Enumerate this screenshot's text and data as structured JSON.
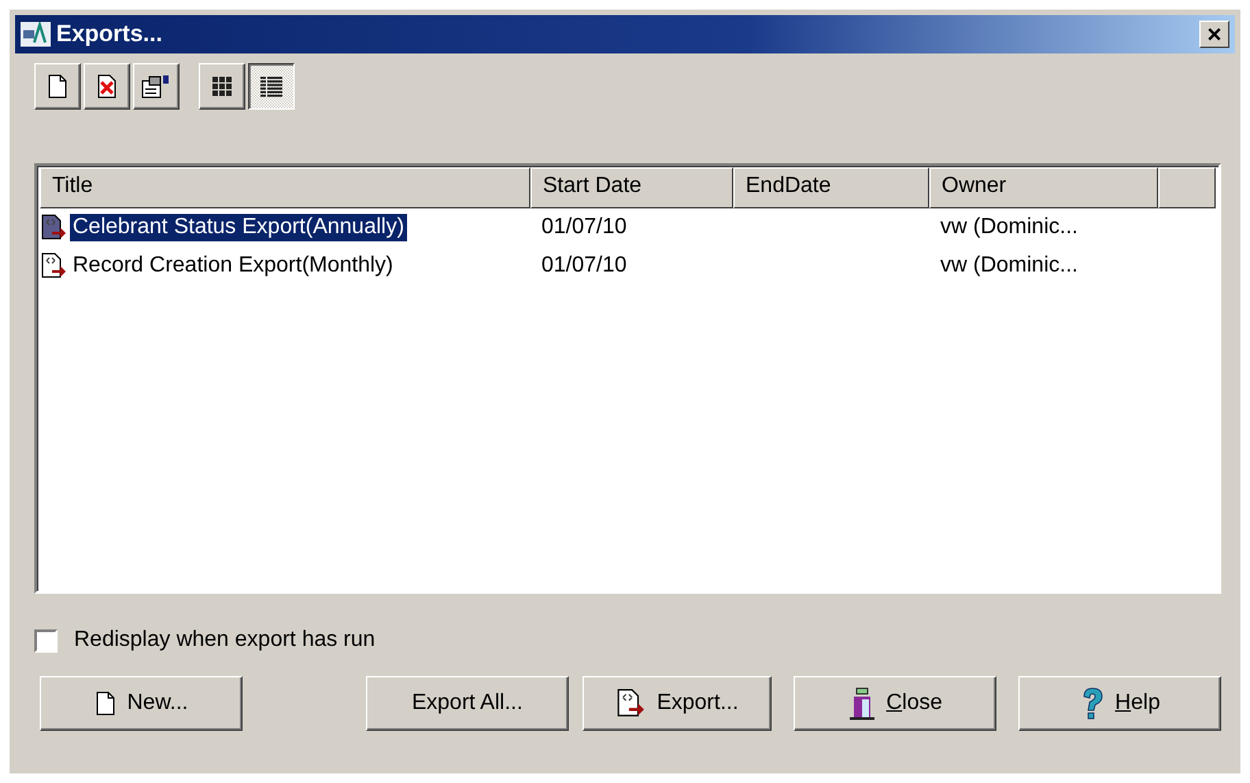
{
  "window": {
    "title": "Exports...",
    "close": "×"
  },
  "toolbar": [
    {
      "kind": "new",
      "selected": false
    },
    {
      "kind": "delete",
      "selected": false
    },
    {
      "kind": "properties",
      "selected": false
    },
    {
      "kind": "icons-view",
      "selected": false
    },
    {
      "kind": "details-view",
      "selected": true
    }
  ],
  "table": {
    "columns": [
      "Title",
      "Start Date",
      "EndDate",
      "Owner"
    ],
    "rows": [
      {
        "title": "Celebrant Status Export(Annually)",
        "start_date": "01/07/10",
        "owner": "vw (Dominic...",
        "selected": true
      },
      {
        "title": "Record Creation Export(Monthly)",
        "start_date": "01/07/10",
        "owner": "vw (Dominic...",
        "selected": false
      }
    ]
  },
  "checkbox": {
    "label": "Redisplay when export has run",
    "checked": false
  },
  "buttons": [
    {
      "kind": "new",
      "label": "New..."
    },
    {
      "kind": "plain",
      "label": "Export All..."
    },
    {
      "kind": "export",
      "label": "Export..."
    },
    {
      "kind": "close",
      "mnemonic": "C",
      "rest": "lose"
    },
    {
      "kind": "help",
      "mnemonic": "H",
      "rest": "elp"
    }
  ]
}
